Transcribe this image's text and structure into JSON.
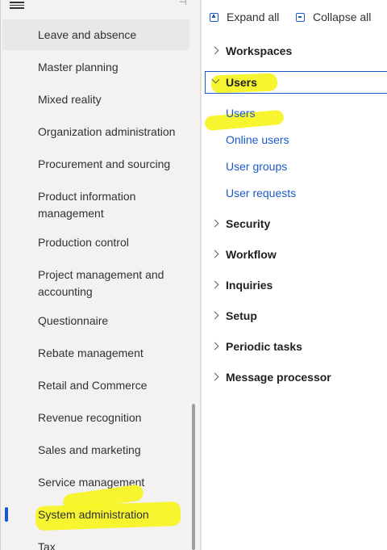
{
  "nav": {
    "items": [
      {
        "label": "Leave and absence"
      },
      {
        "label": "Master planning"
      },
      {
        "label": "Mixed reality"
      },
      {
        "label": "Organization administration"
      },
      {
        "label": "Procurement and sourcing"
      },
      {
        "label": "Product information management"
      },
      {
        "label": "Production control"
      },
      {
        "label": "Project management and accounting"
      },
      {
        "label": "Questionnaire"
      },
      {
        "label": "Rebate management"
      },
      {
        "label": "Retail and Commerce"
      },
      {
        "label": "Revenue recognition"
      },
      {
        "label": "Sales and marketing"
      },
      {
        "label": "Service management"
      },
      {
        "label": "System administration"
      },
      {
        "label": "Tax"
      }
    ],
    "selected_label": "System administration",
    "icons": {
      "menu": "hamburger-menu-icon",
      "pin": "pin-icon"
    }
  },
  "toolbar": {
    "expand_all": "Expand all",
    "collapse_all": "Collapse all"
  },
  "groups": {
    "workspaces": "Workspaces",
    "users": "Users",
    "security": "Security",
    "workflow": "Workflow",
    "inquiries": "Inquiries",
    "setup": "Setup",
    "periodic_tasks": "Periodic tasks",
    "message_processor": "Message processor"
  },
  "users_links": {
    "users": "Users",
    "online_users": "Online users",
    "user_groups": "User groups",
    "user_requests": "User requests"
  },
  "colors": {
    "accent": "#1b59c8",
    "highlight": "#f7f325",
    "nav_background": "#f3f2f1"
  }
}
